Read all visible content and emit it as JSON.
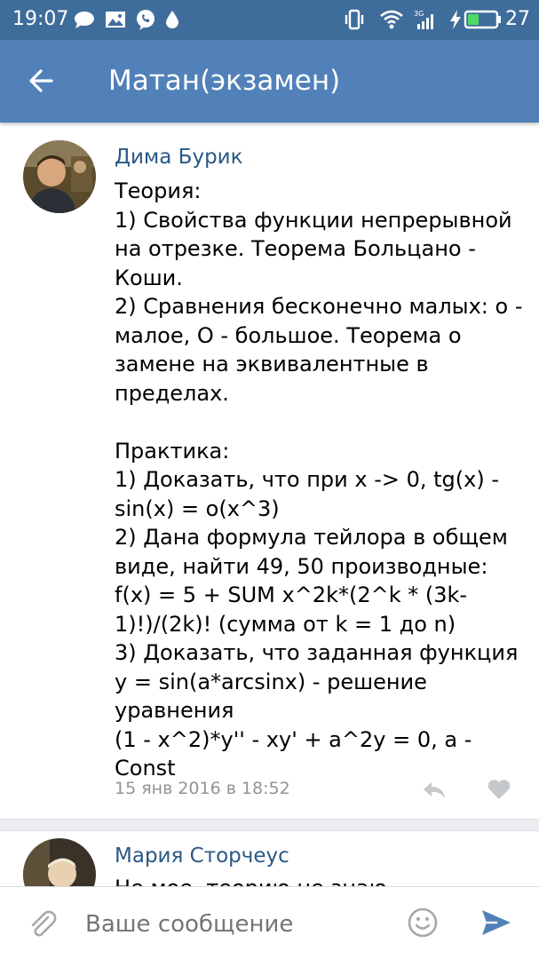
{
  "status_bar": {
    "time": "19:07",
    "battery_level": "27",
    "icons": [
      "chat-icon",
      "image-icon",
      "viber-icon",
      "drop-icon",
      "vibrate-icon",
      "wifi-icon",
      "signal-3g-icon",
      "charging-icon",
      "battery-icon"
    ]
  },
  "toolbar": {
    "title": "Матан(экзамен)",
    "back_icon": "arrow-back-icon"
  },
  "messages": [
    {
      "author": "Дима Бурик",
      "text": "Теория:\n1) Свойства функции непрерывной на отрезке. Теорема Больцано - Коши.\n2) Сравнения бесконечно малых: о - малое, О - большое. Теорема о замене на эквивалентные в пределах.\n\nПрактика:\n1) Доказать, что при  x -> 0, tg(x) - sin(x) = o(x^3)\n2) Дана формула тейлора в общем виде, найти 49, 50 производные:\n    f(x) = 5 + SUM x^2k*(2^k * (3k-1)!)/(2k)!   (сумма от k = 1 до n)\n3) Доказать, что заданная функция y = sin(a*arcsinx) - решение уравнения\n    (1 - x^2)*y'' - xy' + a^2y = 0,    a - Const",
      "date": "15 янв 2016 в 18:52",
      "actions": [
        "reply-icon",
        "like-heart-icon"
      ]
    },
    {
      "author": "Мария Сторчеус",
      "text": "Не мое, теорию не знаю"
    }
  ],
  "composer": {
    "placeholder": "Ваше сообщение",
    "attach_icon": "paperclip-icon",
    "emoji_icon": "smiley-icon",
    "send_icon": "send-icon"
  },
  "colors": {
    "status_bar": "#3f6d9b",
    "toolbar": "#5181b8",
    "author_link": "#2a5885",
    "date": "#939393",
    "send": "#5181b8"
  }
}
